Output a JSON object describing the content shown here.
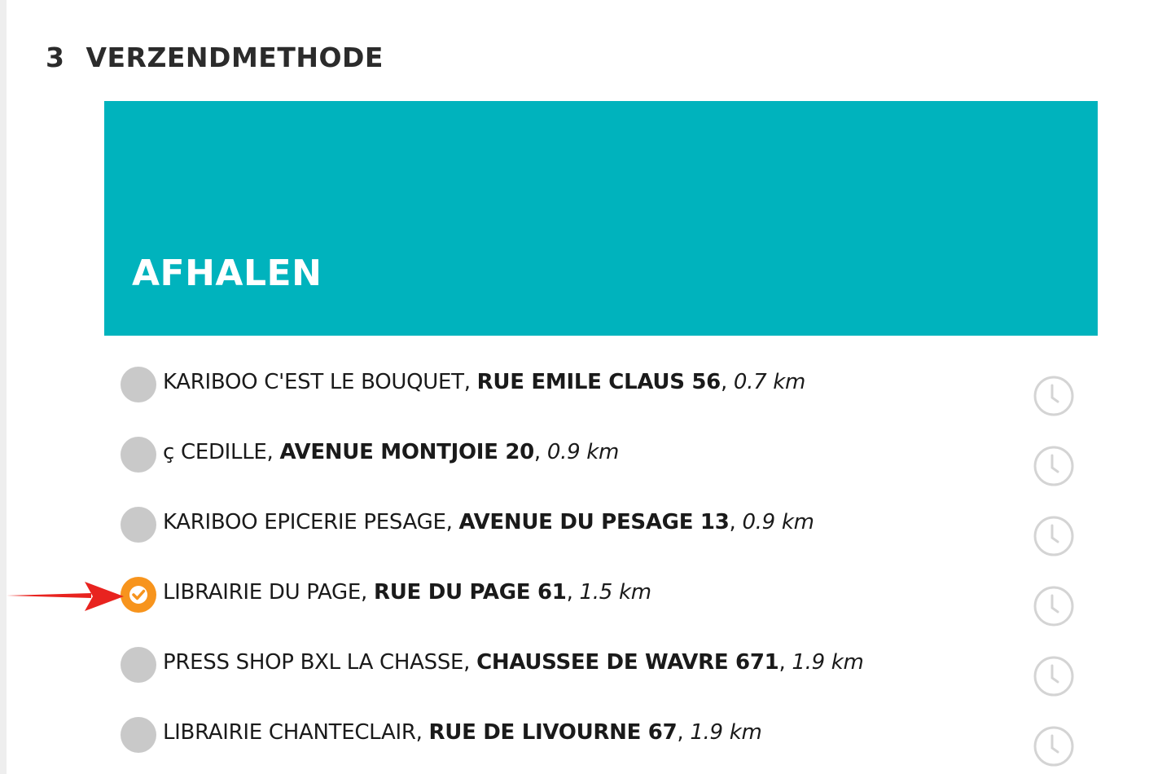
{
  "section": {
    "number": "3",
    "title": "VERZENDMETHODE"
  },
  "banner": {
    "title": "AFHALEN",
    "color": "#00b3bd"
  },
  "colors": {
    "selected": "#f7941d",
    "unselected": "#c9c9c9",
    "clock": "#d4d4d4",
    "arrow": "#e8231f"
  },
  "pickup_points": [
    {
      "name": "KARIBOO C'EST LE BOUQUET",
      "street": "RUE EMILE CLAUS 56",
      "distance": "0.7 km",
      "selected": false
    },
    {
      "name": "ç CEDILLE",
      "street": "AVENUE MONTJOIE 20",
      "distance": "0.9 km",
      "selected": false
    },
    {
      "name": "KARIBOO EPICERIE PESAGE",
      "street": "AVENUE DU PESAGE 13",
      "distance": "0.9 km",
      "selected": false
    },
    {
      "name": "LIBRAIRIE DU PAGE",
      "street": "RUE DU PAGE 61",
      "distance": "1.5 km",
      "selected": true
    },
    {
      "name": "PRESS SHOP BXL LA CHASSE",
      "street": "CHAUSSEE DE WAVRE 671",
      "distance": "1.9 km",
      "selected": false
    },
    {
      "name": "LIBRAIRIE CHANTECLAIR",
      "street": "RUE DE LIVOURNE 67",
      "distance": "1.9 km",
      "selected": false
    }
  ],
  "icons": {
    "radio_checked": "check-icon",
    "opening_hours": "clock-icon",
    "pointer": "arrow-icon"
  }
}
